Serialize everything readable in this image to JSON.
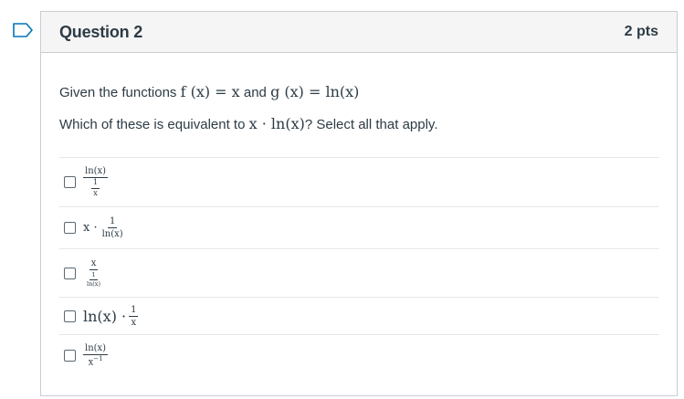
{
  "question": {
    "title": "Question 2",
    "points": "2 pts",
    "given_prefix": "Given the functions ",
    "given_f": "f (x) = x",
    "given_and": " and ",
    "given_g": "g (x) = ln(x)",
    "prompt_prefix": "Which of these is equivalent to ",
    "prompt_expr": "x · ln(x)",
    "prompt_suffix": "? Select all that apply."
  },
  "answers": [
    {
      "num": "ln(x)",
      "den_num": "1",
      "den_den": "x",
      "checked": false
    },
    {
      "prefix": "x · ",
      "num": "1",
      "den": "ln(x)",
      "checked": false
    },
    {
      "num": "x",
      "den_num": "1",
      "den_den": "ln(x)",
      "checked": false
    },
    {
      "prefix": "ln(x) · ",
      "num": "1",
      "den": "x",
      "checked": false
    },
    {
      "num": "ln(x)",
      "den": "x",
      "den_exp": "−1",
      "checked": false
    }
  ],
  "colors": {
    "border": "#c7cdd1",
    "header_bg": "#f5f5f5",
    "text": "#2d3b45",
    "flag": "#0374b5"
  },
  "icons": {
    "flag": "flag-icon"
  }
}
